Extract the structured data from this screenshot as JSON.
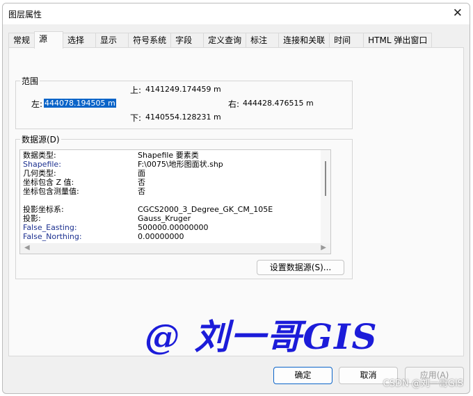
{
  "window": {
    "title": "图层属性"
  },
  "tabs": [
    "常规",
    "源",
    "选择",
    "显示",
    "符号系统",
    "字段",
    "定义查询",
    "标注",
    "连接和关联",
    "时间",
    "HTML 弹出窗口"
  ],
  "extent": {
    "legend": "范围",
    "top_label": "上:",
    "top": "4141249.174459 m",
    "left_label": "左:",
    "left": "444078.194505 m",
    "right_label": "右:",
    "right": "444428.476515 m",
    "bottom_label": "下:",
    "bottom": "4140554.128231 m"
  },
  "datasource": {
    "legend": "数据源(D)",
    "rows": [
      {
        "k": "数据类型:",
        "v": "Shapefile 要素类"
      },
      {
        "k": "Shapefile:",
        "v": "F:\\0075\\地形图面状.shp"
      },
      {
        "k": "几何类型:",
        "v": "面"
      },
      {
        "k": "坐标包含 Z 值:",
        "v": "否"
      },
      {
        "k": "坐标包含测量值:",
        "v": "否"
      },
      {
        "k": "投影坐标系:",
        "v": "CGCS2000_3_Degree_GK_CM_105E"
      },
      {
        "k": "投影:",
        "v": "Gauss_Kruger"
      },
      {
        "k": "False_Easting:",
        "v": "500000.00000000"
      },
      {
        "k": "False_Northing:",
        "v": "0.00000000"
      }
    ],
    "set_button": "设置数据源(S)..."
  },
  "watermark": "@ 刘一哥GIS",
  "buttons": {
    "ok": "确定",
    "cancel": "取消",
    "apply": "应用(A)"
  },
  "csdn": "CSDN @刘一哥GIS"
}
